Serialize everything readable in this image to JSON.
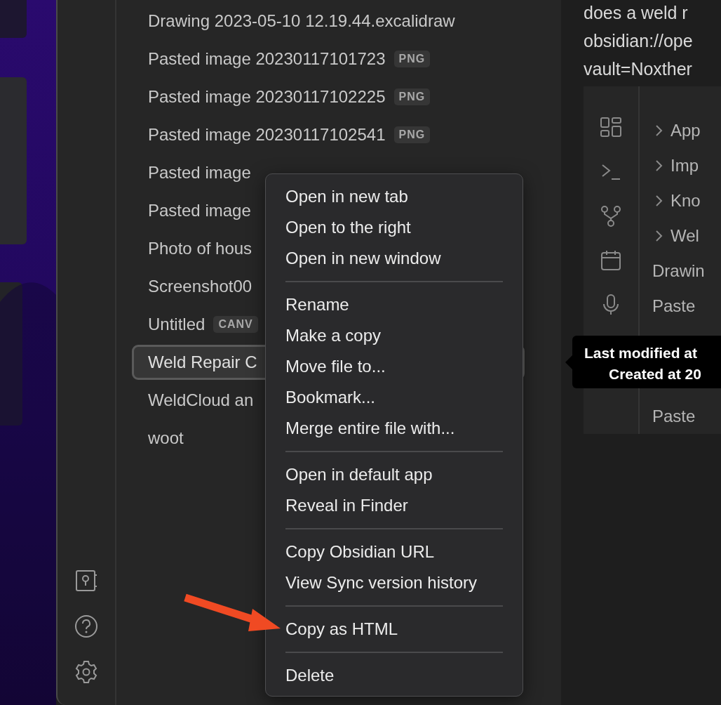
{
  "files": [
    {
      "name": "Drawing 2023-05-10 12.19.44.excalidraw",
      "selected": false
    },
    {
      "name": "Pasted image 20230117101723",
      "badge": "PNG",
      "selected": false
    },
    {
      "name": "Pasted image 20230117102225",
      "badge": "PNG",
      "selected": false
    },
    {
      "name": "Pasted image 20230117102541",
      "badge": "PNG",
      "selected": false
    },
    {
      "name": "Pasted image",
      "selected": false
    },
    {
      "name": "Pasted image",
      "selected": false
    },
    {
      "name": "Photo of hous",
      "selected": false
    },
    {
      "name": "Screenshot00",
      "selected": false
    },
    {
      "name": "Untitled",
      "badge": "CANV",
      "selected": false
    },
    {
      "name": "Weld Repair C",
      "selected": true
    },
    {
      "name": "WeldCloud an",
      "selected": false
    },
    {
      "name": "woot",
      "selected": false
    }
  ],
  "context_menu": {
    "sections": [
      {
        "items": [
          "Open in new tab",
          "Open to the right",
          "Open in new window"
        ]
      },
      {
        "items": [
          "Rename",
          "Make a copy",
          "Move file to...",
          "Bookmark...",
          "Merge entire file with..."
        ]
      },
      {
        "items": [
          "Open in default app",
          "Reveal in Finder"
        ]
      },
      {
        "items": [
          "Copy Obsidian URL",
          "View Sync version history"
        ]
      },
      {
        "items": [
          "Copy as HTML"
        ]
      },
      {
        "items": [
          "Delete"
        ]
      }
    ]
  },
  "note_lines": [
    "does a weld r",
    "obsidian://ope",
    "vault=Noxther"
  ],
  "embedded_screenshot": {
    "tree": [
      {
        "kind": "folder",
        "name": "App"
      },
      {
        "kind": "folder",
        "name": "Imp"
      },
      {
        "kind": "folder",
        "name": "Kno"
      },
      {
        "kind": "folder",
        "name": "Wel"
      },
      {
        "kind": "file",
        "name": "Drawin"
      },
      {
        "kind": "file",
        "name": "Paste"
      },
      {
        "kind": "file",
        "name": "Paste"
      }
    ]
  },
  "tooltip": {
    "lines": [
      "Last modified at",
      "Created at 20"
    ]
  }
}
